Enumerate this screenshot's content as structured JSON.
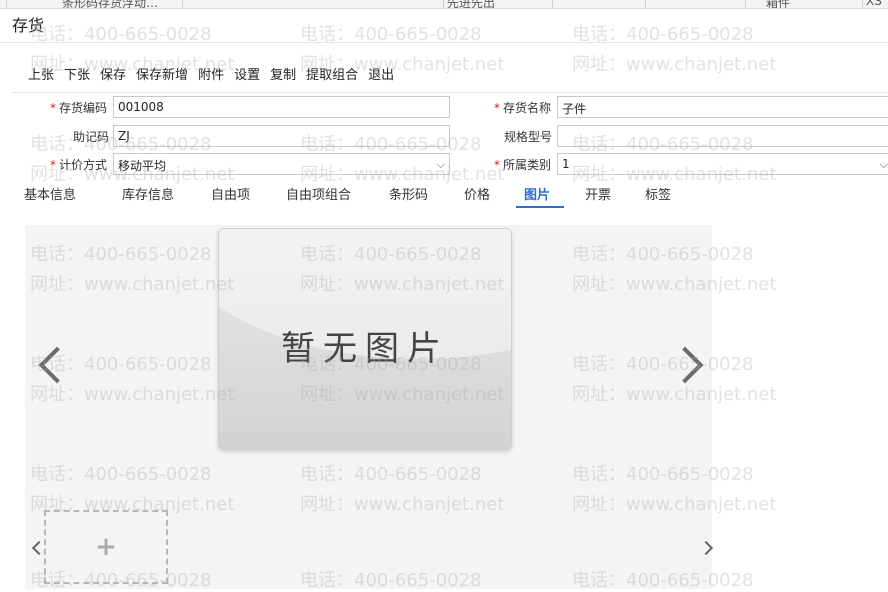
{
  "top_strip": [
    "条形码存货浮动…",
    "先进先出",
    "箱件",
    "XS"
  ],
  "window_title": "存货",
  "toolbar": [
    "上张",
    "下张",
    "保存",
    "保存新增",
    "附件",
    "设置",
    "复制",
    "提取组合",
    "退出"
  ],
  "form": {
    "code_label": "存货编码",
    "code_value": "001008",
    "name_label": "存货名称",
    "name_value": "子件",
    "mnemonic_label": "助记码",
    "mnemonic_value": "ZJ",
    "spec_label": "规格型号",
    "spec_value": "",
    "pricing_label": "计价方式",
    "pricing_value": "移动平均",
    "category_label": "所属类别",
    "category_value": "1",
    "required_mark": "*"
  },
  "tabs": [
    "基本信息",
    "库存信息",
    "自由项",
    "自由项组合",
    "条形码",
    "价格",
    "图片",
    "开票",
    "标签"
  ],
  "active_tab_index": 6,
  "gallery": {
    "no_image_text": "暂无图片",
    "upload_symbol": "+"
  },
  "watermark": {
    "phone": "电话：400-665-0028",
    "site": "网址：www.chanjet.net"
  },
  "colors": {
    "accent": "#2b6fd6",
    "required": "#e02020"
  }
}
